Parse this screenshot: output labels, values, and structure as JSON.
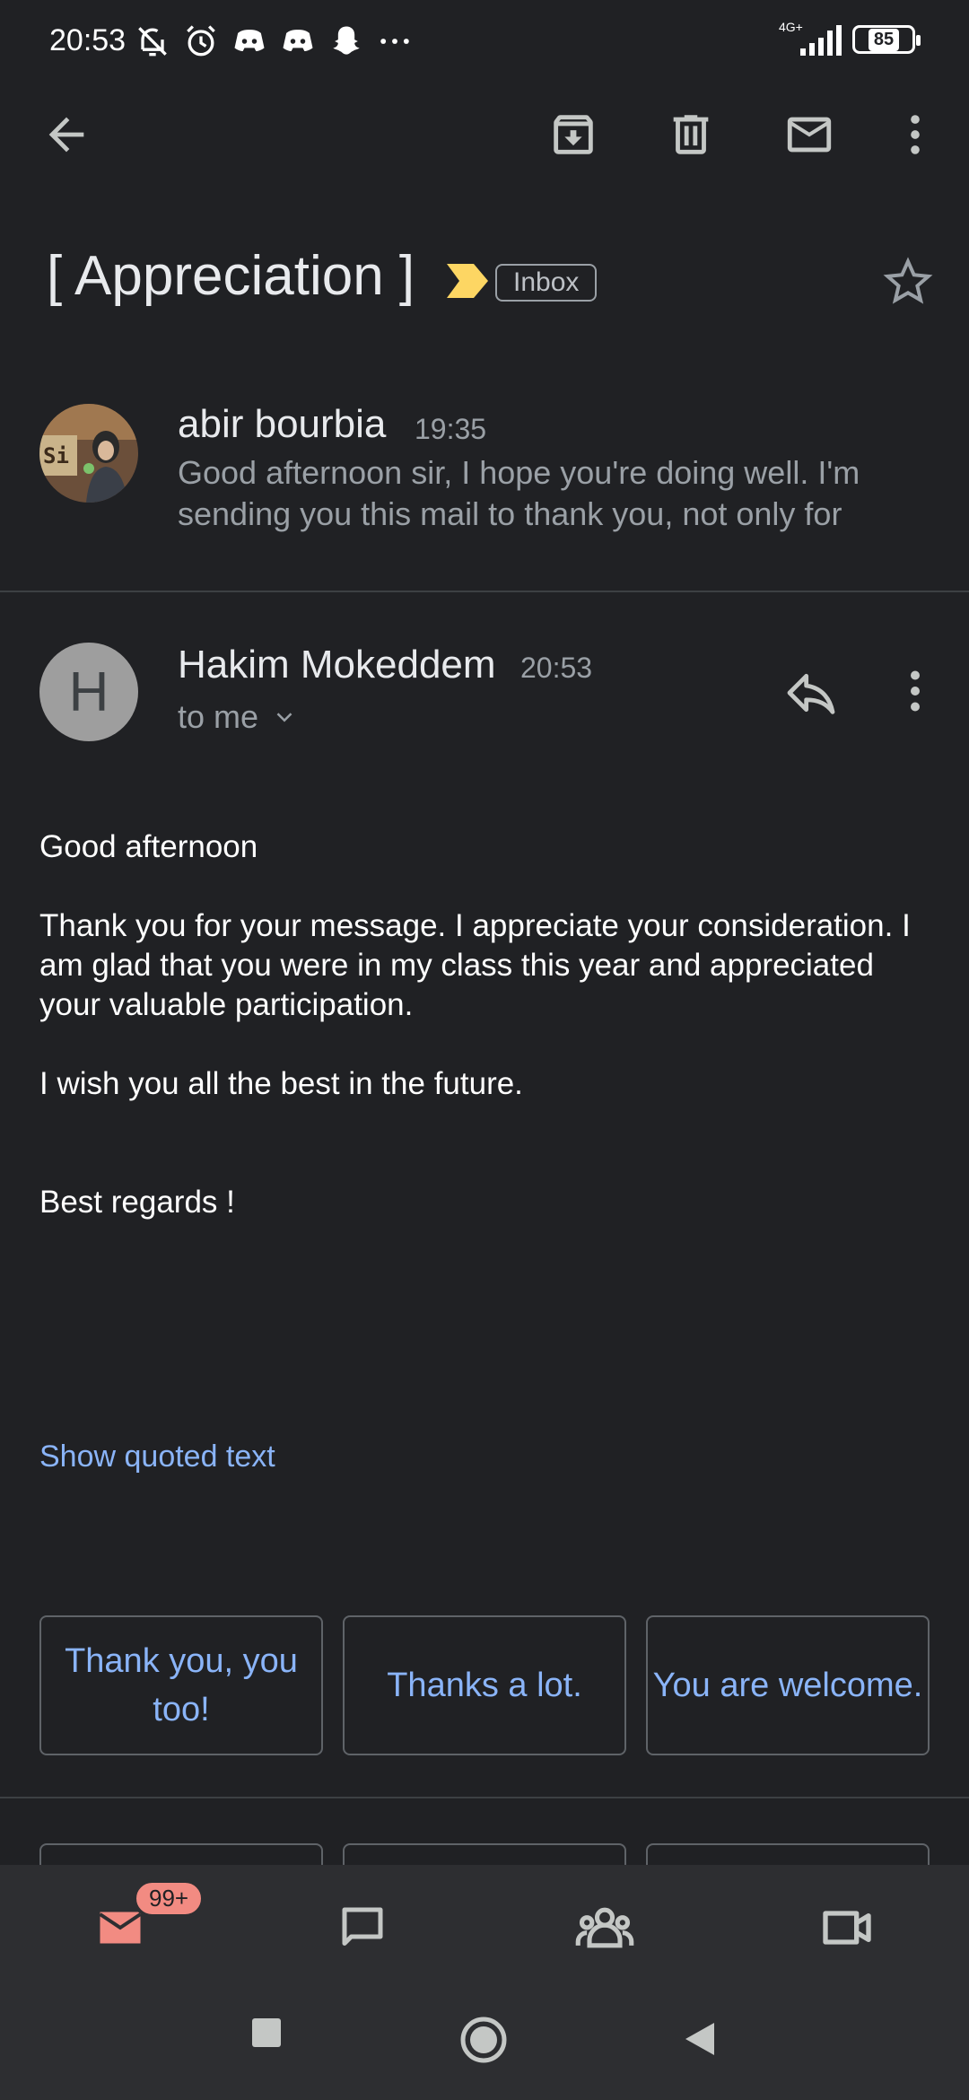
{
  "status_bar": {
    "time": "20:53",
    "network": "4G+",
    "battery": "85"
  },
  "toolbar": {
    "back": "arrow-back-icon",
    "archive": "archive-icon",
    "delete": "delete-icon",
    "mark_unread": "mail-icon",
    "more": "more-vert-icon"
  },
  "subject": "[ Appreciation ]",
  "label": "Inbox",
  "colors": {
    "background": "#202124",
    "link": "#8ab4f8",
    "importance": "#fdd663",
    "badge": "#f28b82",
    "mail_icon": "#f28b82"
  },
  "messages": [
    {
      "sender": "abir bourbia",
      "time": "19:35",
      "snippet": "Good afternoon sir, I hope you're doing well. I'm sending you this mail to thank you, not only for"
    },
    {
      "avatar_letter": "H",
      "sender": "Hakim Mokeddem",
      "time": "20:53",
      "recipient": "to me",
      "body": [
        "Good afternoon",
        "Thank you for your message. I appreciate your consideration. I am glad that you were in my class this year and appreciated your valuable participation.",
        "I wish you all the best in the future.",
        "Best regards !"
      ],
      "show_quoted": "Show quoted text"
    }
  ],
  "smart_replies": [
    "Thank you, you too!",
    "Thanks a lot.",
    "You are welcome."
  ],
  "bottom_nav": {
    "badge": "99+",
    "items": [
      "mail-icon",
      "chat-icon",
      "spaces-icon",
      "meet-icon"
    ]
  }
}
